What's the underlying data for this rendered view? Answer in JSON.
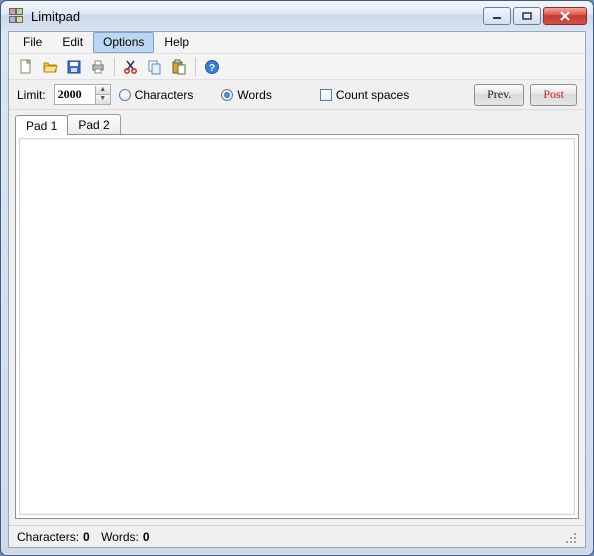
{
  "window": {
    "title": "Limitpad"
  },
  "menu": {
    "items": [
      "File",
      "Edit",
      "Options",
      "Help"
    ],
    "active_index": 2
  },
  "toolbar": {
    "icons": [
      "new",
      "open",
      "save",
      "print",
      "cut",
      "copy",
      "paste",
      "help"
    ]
  },
  "options": {
    "limit_label": "Limit:",
    "limit_value": "2000",
    "radio_characters": "Characters",
    "radio_words": "Words",
    "radio_selected": "words",
    "count_spaces_label": "Count spaces",
    "count_spaces_checked": false,
    "prev_label": "Prev.",
    "post_label": "Post"
  },
  "tabs": {
    "items": [
      "Pad 1",
      "Pad 2"
    ],
    "active_index": 0
  },
  "editor": {
    "content": ""
  },
  "status": {
    "chars_label": "Characters:",
    "chars_value": "0",
    "words_label": "Words:",
    "words_value": "0"
  }
}
